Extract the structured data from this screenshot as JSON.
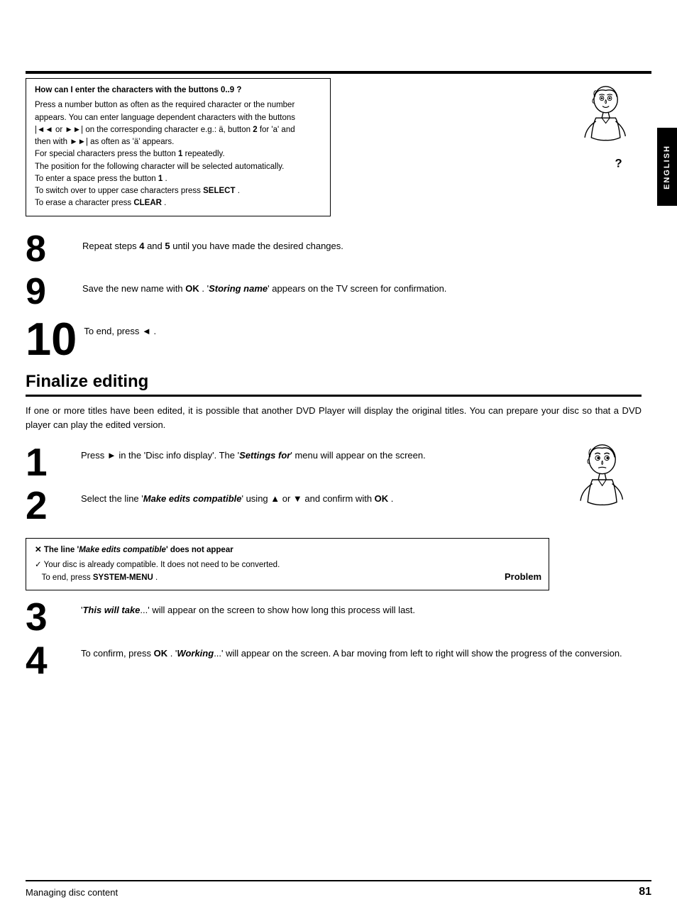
{
  "english_tab": "ENGLISH",
  "info_box": {
    "question": "How can I enter the characters with the buttons  0..9 ?",
    "lines": [
      "Press a number button as often as the required character or the number",
      "appears. You can enter language dependent characters with the buttons",
      "|◄◄ or ►►| on the corresponding character e.g.: ä, button  2 for 'a' and",
      "then with ►►| as often as 'ä' appears.",
      "For special characters press the button  1 repeatedly.",
      "The position for the following character will be selected automatically.",
      "To enter a space press the button  1 .",
      "To switch over to upper case characters press  SELECT .",
      "To erase a character press  CLEAR ."
    ],
    "question_mark": "?"
  },
  "steps_top": [
    {
      "num": "8",
      "text": "Repeat steps 4 and 5 until you have made the desired changes."
    },
    {
      "num": "9",
      "text": "Save the new name with  OK . 'Storing name' appears on the TV screen for confirmation."
    },
    {
      "num": "10",
      "text": "To end, press ◄ ."
    }
  ],
  "section_title": "Finalize editing",
  "section_desc": "If one or more titles have been edited, it is possible that another DVD Player will display the original titles. You can prepare your disc so that a DVD player can play the edited version.",
  "finalize_steps": [
    {
      "num": "1",
      "text": "Press ► in the 'Disc info display'. The 'Settings for' menu will appear on the screen."
    },
    {
      "num": "2",
      "text": "Select the line 'Make edits compatible' using ▲ or ▼ and confirm with  OK ."
    },
    {
      "num": "3",
      "text": "'This will take...' will appear on the screen to show how long this process will last."
    },
    {
      "num": "4",
      "text": "To confirm, press  OK . 'Working...' will appear on the screen. A bar moving from left to right will show the progress of the conversion."
    }
  ],
  "problem_box": {
    "title": "✕ The line 'Make edits compatible' does not appear",
    "line1": "✓ Your disc is already compatible. It does not need to be converted.",
    "line2": "To end, press  SYSTEM-MENU .",
    "label": "Problem"
  },
  "footer": {
    "left": "Managing disc content",
    "right": "81"
  }
}
